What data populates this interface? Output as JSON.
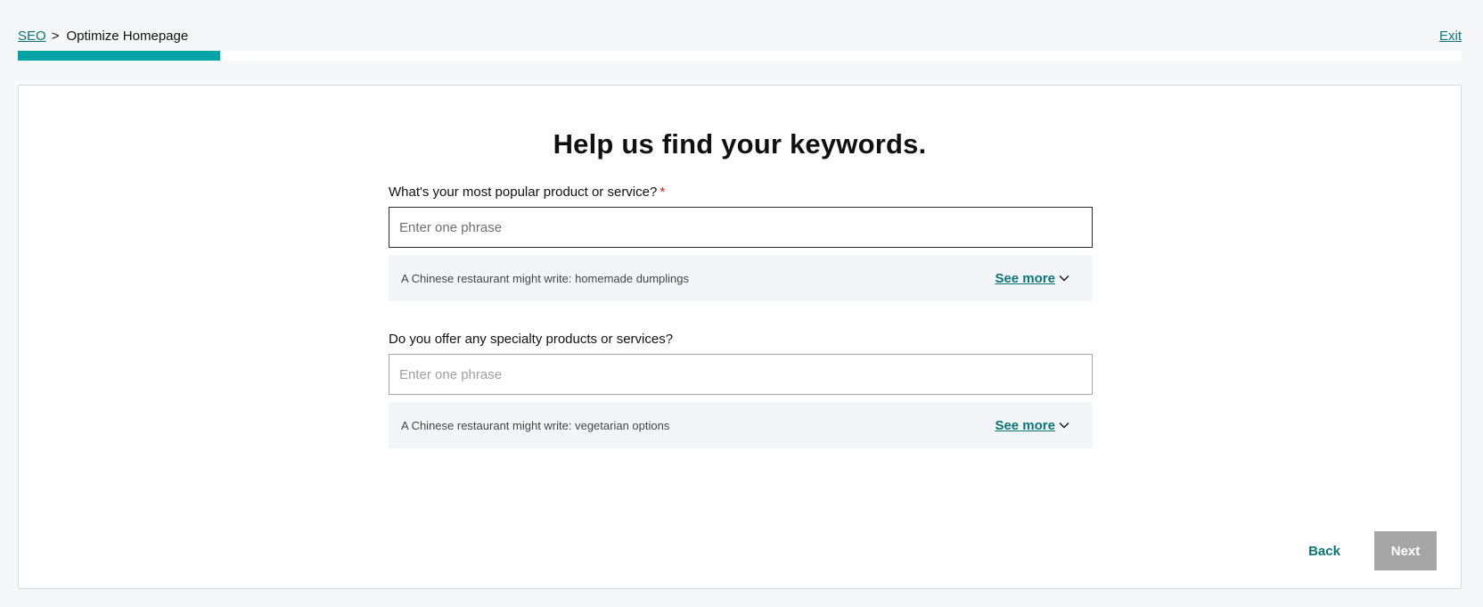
{
  "breadcrumb": {
    "parent": "SEO",
    "separator": ">",
    "current": "Optimize Homepage"
  },
  "exit_label": "Exit",
  "progress": {
    "percent": 14,
    "color": "#00a4a6"
  },
  "heading": "Help us find your keywords.",
  "fields": [
    {
      "label": "What's your most popular product or service?",
      "required_marker": "*",
      "value": "",
      "placeholder": "Enter one phrase",
      "hint": "A Chinese restaurant might write: homemade dumplings",
      "see_more": "See more"
    },
    {
      "label": "Do you offer any specialty products or services?",
      "value": "",
      "placeholder": "Enter one phrase",
      "hint": "A Chinese restaurant might write: vegetarian options",
      "see_more": "See more"
    }
  ],
  "buttons": {
    "back": "Back",
    "next": "Next"
  },
  "colors": {
    "accent": "#09757a",
    "required": "#db1802",
    "disabled": "#a6a6a6"
  }
}
